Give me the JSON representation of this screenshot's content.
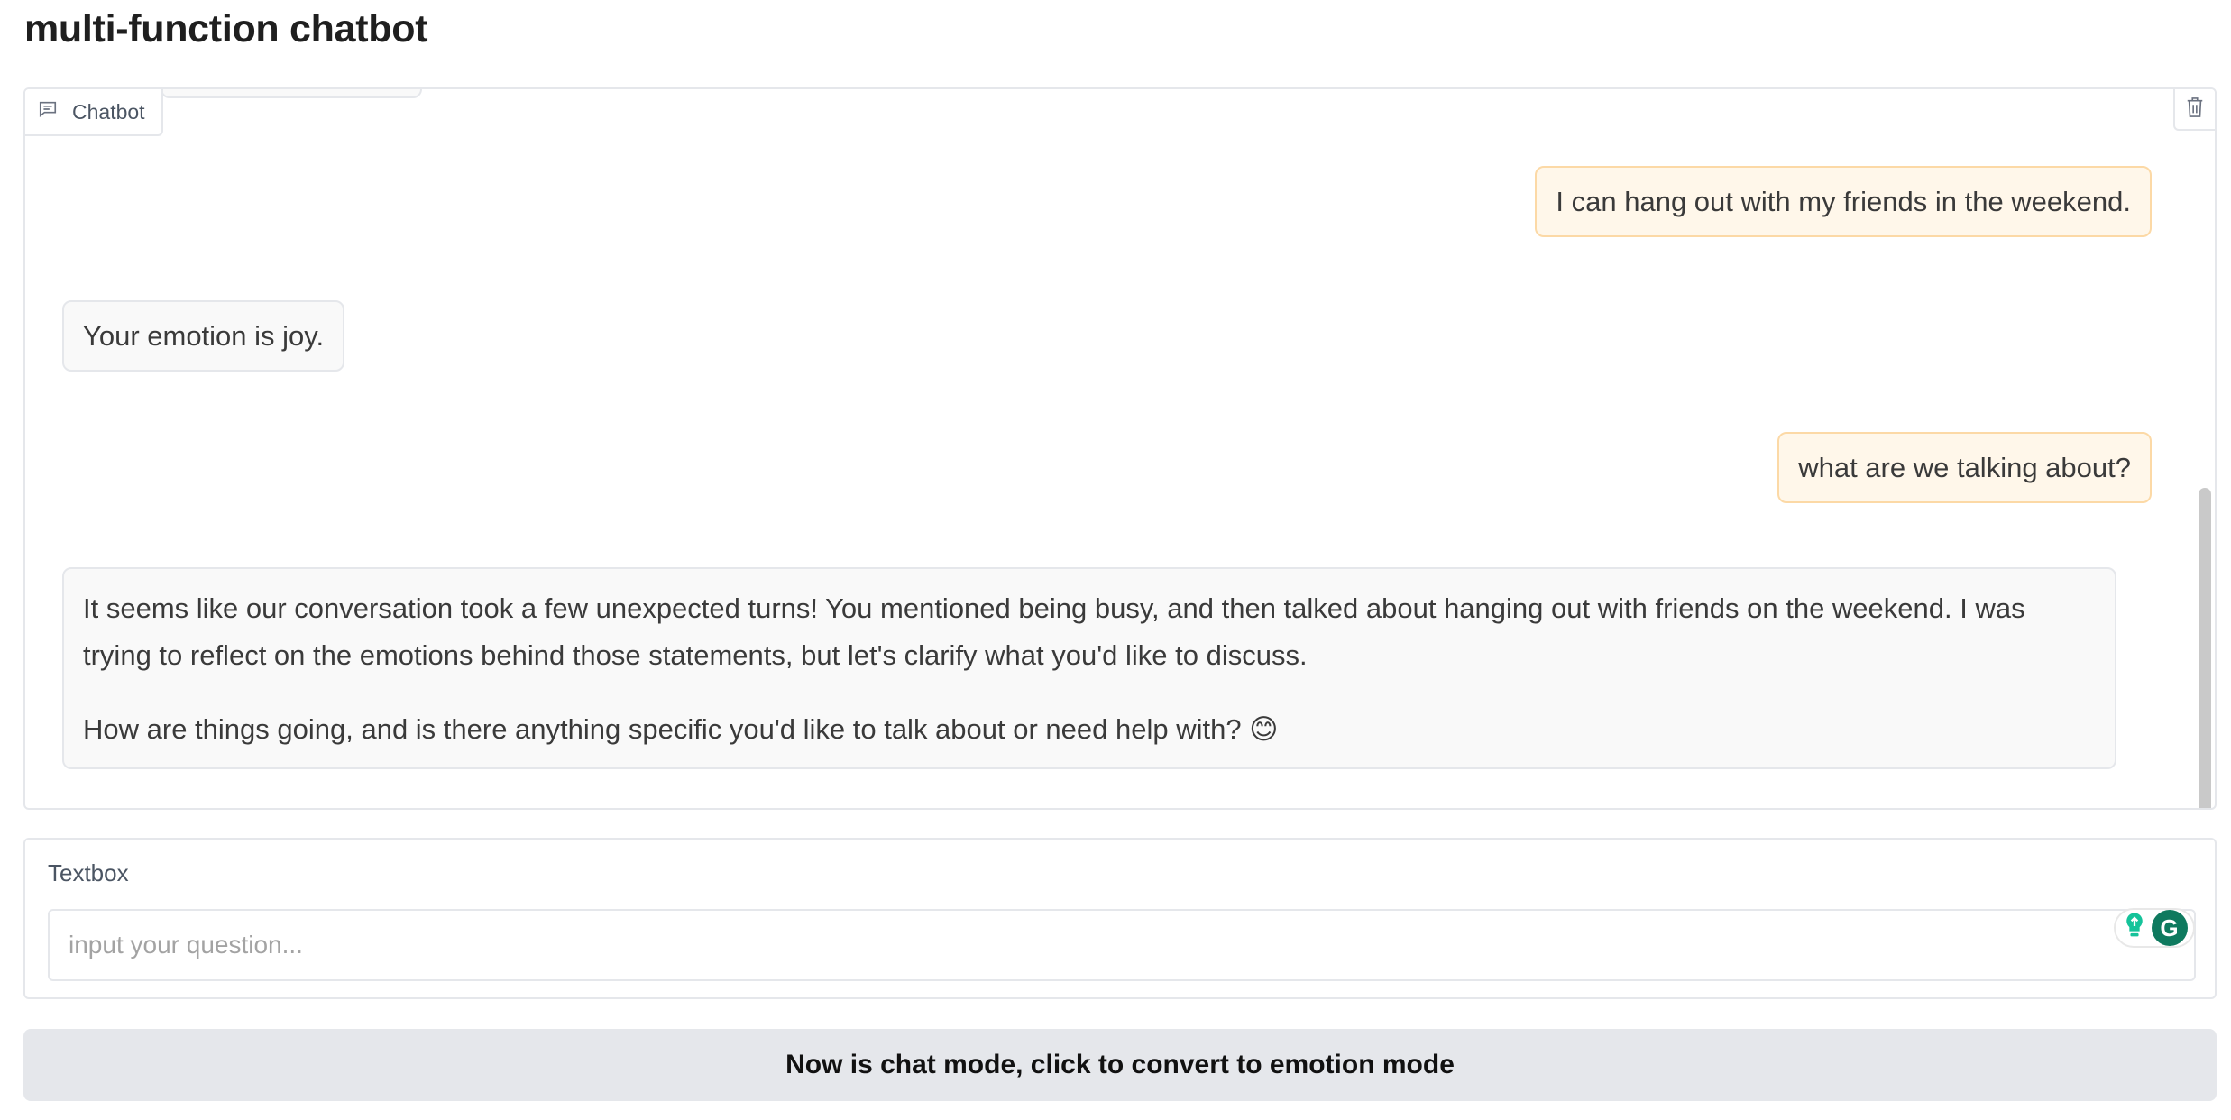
{
  "page": {
    "title": "multi-function chatbot"
  },
  "chatbot": {
    "label": "Chatbot",
    "messages": [
      {
        "role": "user",
        "text": "I can hang out with my friends in the weekend."
      },
      {
        "role": "bot",
        "text": "Your emotion is joy."
      },
      {
        "role": "user",
        "text": "what are we talking about?"
      },
      {
        "role": "bot",
        "paragraph_1": "It seems like our conversation took a few unexpected turns! You mentioned being busy, and then talked about hanging out with friends on the weekend. I was trying to reflect on the emotions behind those statements, but let's clarify what you'd like to discuss.",
        "paragraph_2": "How are things going, and is there anything specific you'd like to talk about or need help with? 😊"
      }
    ]
  },
  "textbox": {
    "label": "Textbox",
    "placeholder": "input your question...",
    "value": ""
  },
  "mode_button": {
    "label": "Now is chat mode, click to convert to emotion mode"
  },
  "icons": {
    "chatbot_label_icon": "chat-bubble-icon",
    "clear_icon": "trash-icon",
    "grammarly_icons": [
      "lightbulb-icon",
      "grammarly-icon"
    ]
  },
  "colors": {
    "user_bubble_bg": "#fff7ea",
    "user_bubble_border": "#fcd9a6",
    "bot_bubble_bg": "#f9f9f9",
    "button_bg": "#e5e7eb",
    "grammarly_green": "#15c39a"
  }
}
